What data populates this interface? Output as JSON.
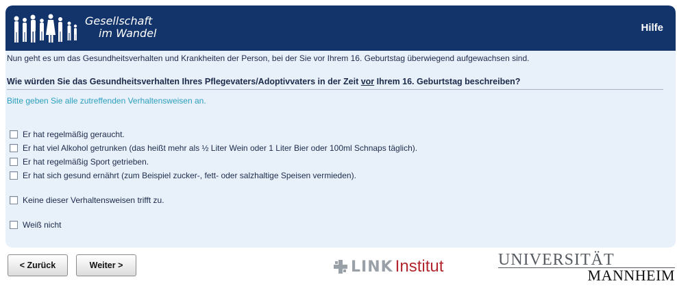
{
  "header": {
    "logo_line1": "Gesellschaft",
    "logo_line2": "im Wandel",
    "help_label": "Hilfe"
  },
  "survey": {
    "intro": "Nun geht es um das Gesundheitsverhalten und Krankheiten der Person, bei der Sie vor Ihrem 16. Geburtstag überwiegend aufgewachsen sind.",
    "question_before": "Wie würden Sie das Gesundheitsverhalten Ihres Pflegevaters/Adoptivvaters in der Zeit ",
    "question_underlined": "vor",
    "question_after": " Ihrem 16. Geburtstag beschreiben?",
    "instruction": "Bitte geben Sie alle zutreffenden Verhaltensweisen an.",
    "options": [
      "Er hat regelmäßig geraucht.",
      "Er hat viel Alkohol getrunken (das heißt mehr als ½ Liter Wein oder 1 Liter Bier oder 100ml Schnaps täglich).",
      "Er hat regelmäßig Sport getrieben.",
      "Er hat sich gesund ernährt (zum Beispiel zucker-, fett- oder salzhaltige Speisen vermieden).",
      "Keine dieser Verhaltensweisen trifft zu.",
      "Weiß nicht"
    ]
  },
  "nav": {
    "back_label": "< Zurück",
    "next_label": "Weiter >"
  },
  "footer": {
    "link_word": "LINK",
    "institut_word": "Institut",
    "uni_line1": "UNIVERSITÄT",
    "uni_line2": "MANNHEIM"
  },
  "colors": {
    "header_bg": "#13336b",
    "panel_bg": "#e8f0fa",
    "instruction": "#2b9fbe",
    "institut_red": "#b3262f"
  }
}
